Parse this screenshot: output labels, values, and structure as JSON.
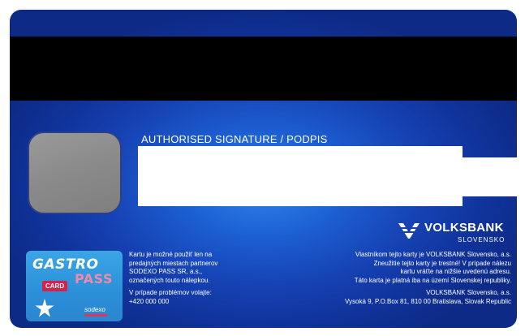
{
  "signature": {
    "label": "AUTHORISED SIGNATURE / PODPIS"
  },
  "bank_logo": {
    "name": "VOLKSBANK",
    "country": "SLOVENSKO",
    "color": "#ffffff"
  },
  "gastro_pass": {
    "word1": "GASTRO",
    "word2": "PASS",
    "badge": "CARD",
    "brand": "sodexo",
    "colors": {
      "background": "#3aa6e6",
      "pass": "#f08aa8",
      "badge": "#d8204a"
    }
  },
  "info_left": {
    "lines": [
      "Kartu je možné použiť len na",
      "predajných miestach partnerov",
      "SODEXO PASS SR, a.s.,",
      "označených touto nálepkou."
    ],
    "contact_lines": [
      "V prípade problémov volajte:",
      "+420 000 000"
    ]
  },
  "info_right": {
    "lines": [
      "Vlastníkom tejto karty je VOLKSBANK Slovensko, a.s.",
      "Zneužitie tejto karty je trestné! V prípade nálezu",
      "kartu vráťte na nižšie uvedenú adresu.",
      "Táto karta je platná iba na území Slovenskej republiky."
    ],
    "address_lines": [
      "VOLKSBANK Slovensko, a.s.",
      "Vysoká 9, P.O.Box 81, 810 00 Bratislava, Slovak Republic"
    ]
  }
}
